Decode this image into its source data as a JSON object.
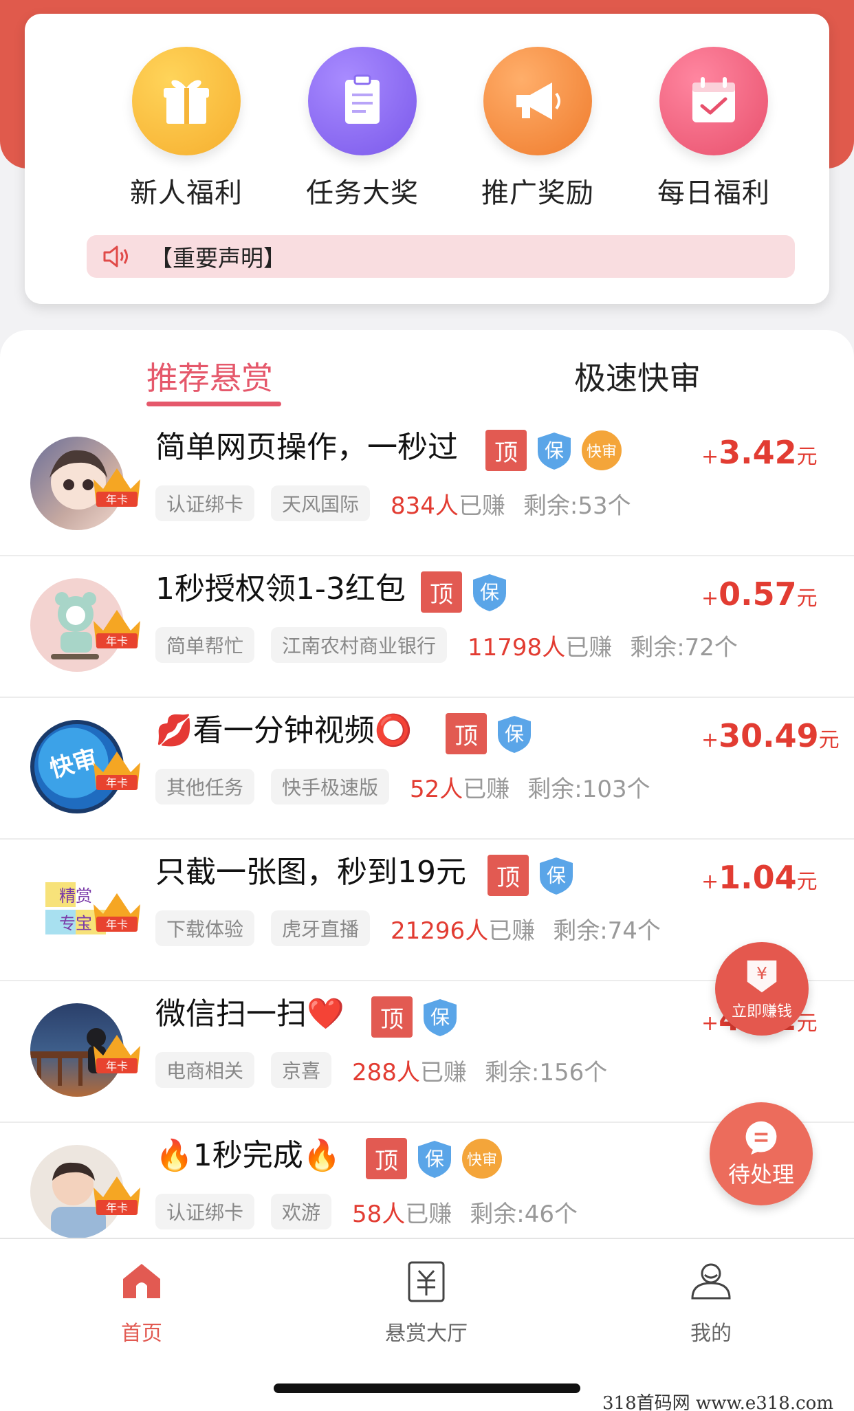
{
  "quick_actions": [
    {
      "label": "新人福利",
      "icon": "gift-icon",
      "color": "#f8b83c"
    },
    {
      "label": "任务大奖",
      "icon": "clipboard-icon",
      "color": "#8a6cf0"
    },
    {
      "label": "推广奖励",
      "icon": "megaphone-icon",
      "color": "#f38a3c"
    },
    {
      "label": "每日福利",
      "icon": "calendar-check-icon",
      "color": "#ef5f7a"
    }
  ],
  "notice": {
    "text": "【重要声明】",
    "icon": "speaker-icon"
  },
  "tabs": [
    {
      "label": "推荐悬赏",
      "active": true
    },
    {
      "label": "极速快审",
      "active": false
    }
  ],
  "common": {
    "vip_badge": "年卡",
    "badge_top": "顶",
    "badge_guarantee": "保",
    "badge_fast": "快审",
    "reward_plus": "+",
    "reward_unit": "元",
    "earned_suffix": "已赚",
    "remaining_prefix": "剩余:"
  },
  "tasks": [
    {
      "title": "简单网页操作，一秒过",
      "fast": true,
      "reward": "3.42",
      "tags": [
        "认证绑卡",
        "天风国际"
      ],
      "earned": "834人",
      "remaining": "53个"
    },
    {
      "title": "1秒授权领1-3红包",
      "fast": false,
      "reward": "0.57",
      "tags": [
        "简单帮忙",
        "江南农村商业银行"
      ],
      "earned": "11798人",
      "remaining": "72个"
    },
    {
      "title": "💋看一分钟视频⭕",
      "fast": false,
      "reward": "30.49",
      "tags": [
        "其他任务",
        "快手极速版"
      ],
      "earned": "52人",
      "remaining": "103个"
    },
    {
      "title": "只截一张图，秒到19元",
      "fast": false,
      "reward": "1.04",
      "tags": [
        "下载体验",
        "虎牙直播"
      ],
      "earned": "21296人",
      "remaining": "74个"
    },
    {
      "title": "微信扫一扫❤️",
      "fast": false,
      "reward": "4.32",
      "tags": [
        "电商相关",
        "京喜"
      ],
      "earned": "288人",
      "remaining": "156个"
    },
    {
      "title": "🔥1秒完成🔥",
      "fast": true,
      "reward": "",
      "tags": [
        "认证绑卡",
        "欢游"
      ],
      "earned": "58人",
      "remaining": "46个"
    }
  ],
  "avatars": {
    "task3_text": "快审",
    "task4_line1": "精赏",
    "task4_line2": "专宝"
  },
  "float_buttons": {
    "earn": {
      "label": "立即赚钱",
      "symbol": "¥"
    },
    "pending": {
      "label": "待处理"
    }
  },
  "bottom_nav": [
    {
      "label": "首页",
      "icon": "home-icon",
      "active": true
    },
    {
      "label": "悬赏大厅",
      "icon": "reward-hall-icon",
      "active": false
    },
    {
      "label": "我的",
      "icon": "profile-icon",
      "active": false
    }
  ],
  "watermark": "318首码网  www.e318.com",
  "colors": {
    "accent": "#e25a52",
    "tab_active": "#e5586b",
    "header": "#e05a4c"
  }
}
